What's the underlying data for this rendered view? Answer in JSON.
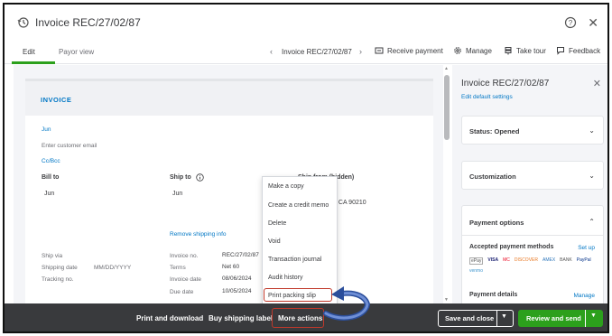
{
  "window": {
    "title": "Invoice REC/27/02/87"
  },
  "tabs": {
    "edit": "Edit",
    "payor_view": "Payor view"
  },
  "nav": {
    "prev": "‹",
    "label": "Invoice REC/27/02/87",
    "next": "›"
  },
  "toolbar": {
    "receive_payment": "Receive payment",
    "manage": "Manage",
    "take_tour": "Take tour",
    "feedback": "Feedback"
  },
  "invoice": {
    "heading": "INVOICE",
    "customer": "Jun",
    "email_placeholder": "Enter customer email",
    "cc_bcc": "Cc/Bcc",
    "bill_to_label": "Bill to",
    "bill_to_value": "Jun",
    "ship_to_label": "Ship to",
    "ship_to_value": "Jun",
    "ship_from_label": "Ship from (hidden)",
    "ship_from_value": ", CA 90210",
    "remove_shipping": "Remove shipping info",
    "ship_via_label": "Ship via",
    "shipping_date_label": "Shipping date",
    "shipping_date_placeholder": "MM/DD/YYYY",
    "tracking_label": "Tracking no.",
    "invoice_no_label": "Invoice no.",
    "invoice_no_value": "REC/27/02/87",
    "terms_label": "Terms",
    "terms_value": "Net 60",
    "invoice_date_label": "Invoice date",
    "invoice_date_value": "08/06/2024",
    "due_date_label": "Due date",
    "due_date_value": "10/05/2024"
  },
  "menu": {
    "items": [
      "Make a copy",
      "Create a credit memo",
      "Delete",
      "Void",
      "Transaction journal",
      "Audit history",
      "Print packing slip"
    ]
  },
  "panel": {
    "title": "Invoice REC/27/02/87",
    "edit_default": "Edit default settings",
    "status": "Status: Opened",
    "customization": "Customization",
    "payment_options": "Payment options",
    "accepted_methods": "Accepted payment methods",
    "setup": "Set up",
    "payment_logos": [
      "ePay",
      "VISA",
      "MC",
      "DISCOVER",
      "AMEX",
      "BANK",
      "PayPal",
      "venmo"
    ],
    "payment_details": "Payment details",
    "manage": "Manage"
  },
  "bottom": {
    "print_download": "Print and download",
    "buy_shipping": "Buy shipping label",
    "more_actions": "More actions",
    "save_close": "Save and close",
    "review_send": "Review and send"
  },
  "colors": {
    "brand_green": "#2ca01c",
    "link_blue": "#0077c5",
    "bottom_bar": "#393a3d",
    "highlight_red": "#c0392b",
    "arrow_blue": "#2b4e9b"
  }
}
